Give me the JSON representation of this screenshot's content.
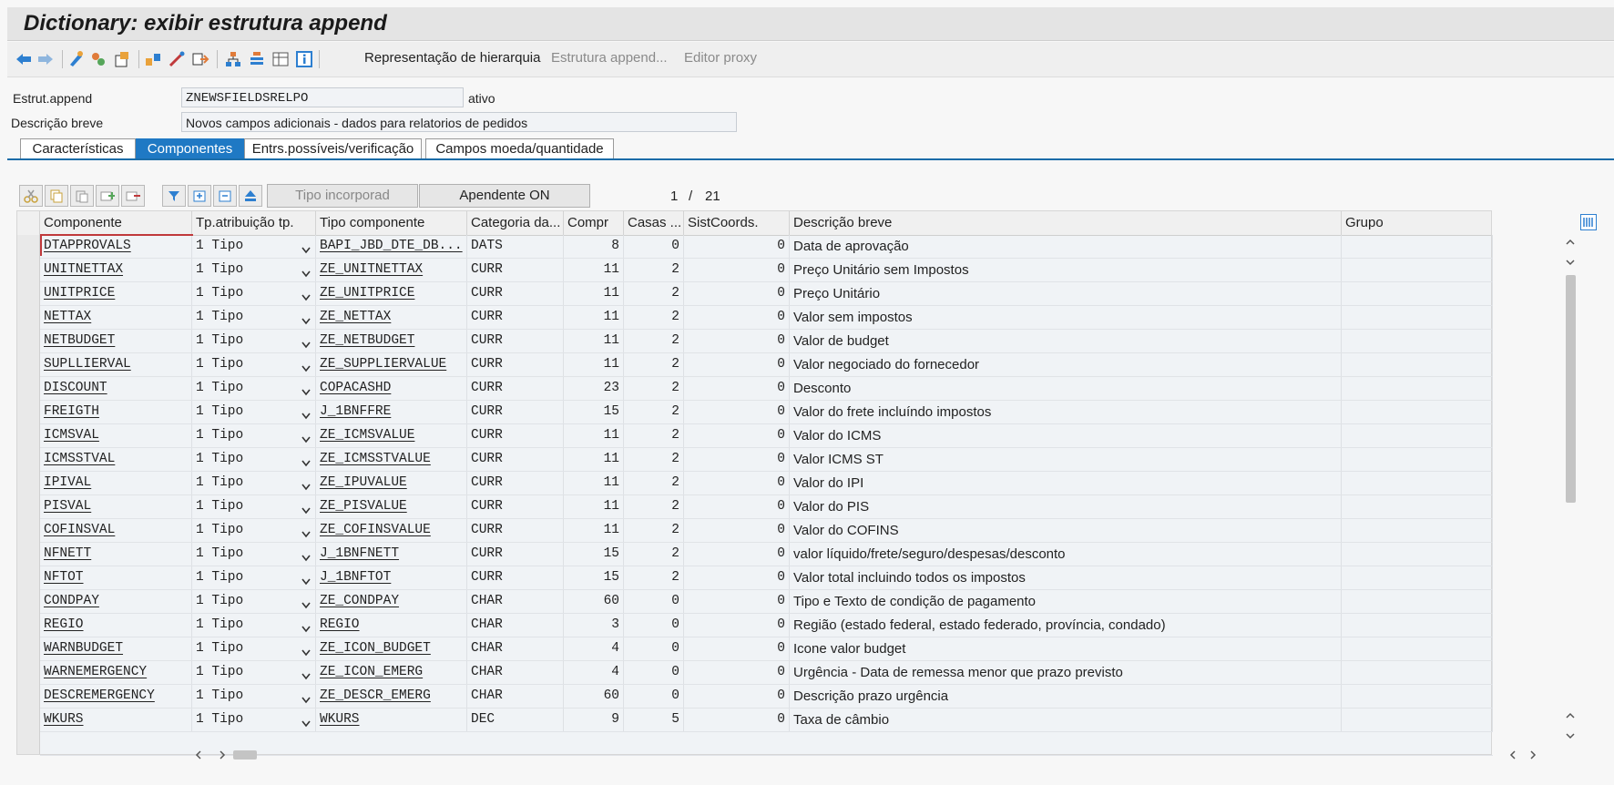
{
  "window": {
    "title": "Dictionary: exibir estrutura append"
  },
  "toolbar": {
    "icons": [
      "back-arrow-icon",
      "forward-arrow-icon",
      "display-change-icon",
      "activate-icon",
      "where-used-icon",
      "object-list-icon",
      "navigation-icon",
      "transport-icon",
      "hierarchy-icon",
      "list-icon",
      "table-icon",
      "info-icon"
    ],
    "hierarchy_label": "Representação de hierarquia",
    "append_label": "Estrutura append...",
    "proxy_label": "Editor proxy"
  },
  "header": {
    "append_label": "Estrut.append",
    "append_value": "ZNEWSFIELDSRELPO",
    "status": "ativo",
    "desc_label": "Descrição breve",
    "desc_value": "Novos campos adicionais - dados para relatorios de pedidos"
  },
  "tabs": [
    {
      "label": "Características",
      "active": false
    },
    {
      "label": "Componentes",
      "active": true
    },
    {
      "label": "Entrs.possíveis/verificação",
      "active": false
    },
    {
      "label": "Campos moeda/quantidade",
      "active": false
    }
  ],
  "grid_toolbar": {
    "tipo_btn": "Tipo incorporad",
    "apendente_btn": "Apendente ON",
    "page_current": "1",
    "page_sep": "/",
    "page_total": "21"
  },
  "columns": [
    "Componente",
    "Tp.atribuição tp.",
    "Tipo componente",
    "Categoria da...",
    "Compr",
    "Casas ...",
    "SistCoords.",
    "Descrição breve",
    "Grupo"
  ],
  "rows": [
    {
      "comp": "DTAPPROVALS",
      "tp": "1 Tipo",
      "type": "BAPI_JBD_DTE_DB...",
      "cat": "DATS",
      "len": "8",
      "dec": "0",
      "coord": "0",
      "desc": "Data de aprovação"
    },
    {
      "comp": "UNITNETTAX",
      "tp": "1 Tipo",
      "type": "ZE_UNITNETTAX",
      "cat": "CURR",
      "len": "11",
      "dec": "2",
      "coord": "0",
      "desc": "Preço Unitário sem Impostos"
    },
    {
      "comp": "UNITPRICE",
      "tp": "1 Tipo",
      "type": "ZE_UNITPRICE",
      "cat": "CURR",
      "len": "11",
      "dec": "2",
      "coord": "0",
      "desc": "Preço Unitário"
    },
    {
      "comp": "NETTAX",
      "tp": "1 Tipo",
      "type": "ZE_NETTAX",
      "cat": "CURR",
      "len": "11",
      "dec": "2",
      "coord": "0",
      "desc": "Valor sem impostos"
    },
    {
      "comp": "NETBUDGET",
      "tp": "1 Tipo",
      "type": "ZE_NETBUDGET",
      "cat": "CURR",
      "len": "11",
      "dec": "2",
      "coord": "0",
      "desc": "Valor de budget"
    },
    {
      "comp": "SUPLLIERVAL",
      "tp": "1 Tipo",
      "type": "ZE_SUPPLIERVALUE",
      "cat": "CURR",
      "len": "11",
      "dec": "2",
      "coord": "0",
      "desc": "Valor negociado do fornecedor"
    },
    {
      "comp": "DISCOUNT",
      "tp": "1 Tipo",
      "type": "COPACASHD",
      "cat": "CURR",
      "len": "23",
      "dec": "2",
      "coord": "0",
      "desc": "Desconto"
    },
    {
      "comp": "FREIGTH",
      "tp": "1 Tipo",
      "type": "J_1BNFFRE",
      "cat": "CURR",
      "len": "15",
      "dec": "2",
      "coord": "0",
      "desc": "Valor do frete incluíndo impostos"
    },
    {
      "comp": "ICMSVAL",
      "tp": "1 Tipo",
      "type": "ZE_ICMSVALUE",
      "cat": "CURR",
      "len": "11",
      "dec": "2",
      "coord": "0",
      "desc": "Valor do ICMS"
    },
    {
      "comp": "ICMSSTVAL",
      "tp": "1 Tipo",
      "type": "ZE_ICMSSTVALUE",
      "cat": "CURR",
      "len": "11",
      "dec": "2",
      "coord": "0",
      "desc": "Valor ICMS ST"
    },
    {
      "comp": "IPIVAL",
      "tp": "1 Tipo",
      "type": "ZE_IPUVALUE",
      "cat": "CURR",
      "len": "11",
      "dec": "2",
      "coord": "0",
      "desc": "Valor do IPI"
    },
    {
      "comp": "PISVAL",
      "tp": "1 Tipo",
      "type": "ZE_PISVALUE",
      "cat": "CURR",
      "len": "11",
      "dec": "2",
      "coord": "0",
      "desc": "Valor do PIS"
    },
    {
      "comp": "COFINSVAL",
      "tp": "1 Tipo",
      "type": "ZE_COFINSVALUE",
      "cat": "CURR",
      "len": "11",
      "dec": "2",
      "coord": "0",
      "desc": "Valor do COFINS"
    },
    {
      "comp": "NFNETT",
      "tp": "1 Tipo",
      "type": "J_1BNFNETT",
      "cat": "CURR",
      "len": "15",
      "dec": "2",
      "coord": "0",
      "desc": "valor líquido/frete/seguro/despesas/desconto"
    },
    {
      "comp": "NFTOT",
      "tp": "1 Tipo",
      "type": "J_1BNFTOT",
      "cat": "CURR",
      "len": "15",
      "dec": "2",
      "coord": "0",
      "desc": "Valor total incluindo todos os impostos"
    },
    {
      "comp": "CONDPAY",
      "tp": "1 Tipo",
      "type": "ZE_CONDPAY",
      "cat": "CHAR",
      "len": "60",
      "dec": "0",
      "coord": "0",
      "desc": "Tipo e Texto de condição de pagamento"
    },
    {
      "comp": "REGIO",
      "tp": "1 Tipo",
      "type": "REGIO",
      "cat": "CHAR",
      "len": "3",
      "dec": "0",
      "coord": "0",
      "desc": "Região (estado federal, estado federado, província, condado)"
    },
    {
      "comp": "WARNBUDGET",
      "tp": "1 Tipo",
      "type": "ZE_ICON_BUDGET",
      "cat": "CHAR",
      "len": "4",
      "dec": "0",
      "coord": "0",
      "desc": "Icone valor budget"
    },
    {
      "comp": "WARNEMERGENCY",
      "tp": "1 Tipo",
      "type": "ZE_ICON_EMERG",
      "cat": "CHAR",
      "len": "4",
      "dec": "0",
      "coord": "0",
      "desc": "Urgência - Data de remessa  menor que prazo previsto"
    },
    {
      "comp": "DESCREMERGENCY",
      "tp": "1 Tipo",
      "type": "ZE_DESCR_EMERG",
      "cat": "CHAR",
      "len": "60",
      "dec": "0",
      "coord": "0",
      "desc": "Descrição prazo urgência"
    },
    {
      "comp": "WKURS",
      "tp": "1 Tipo",
      "type": "WKURS",
      "cat": "DEC",
      "len": "9",
      "dec": "5",
      "coord": "0",
      "desc": "Taxa de câmbio"
    }
  ],
  "colors": {
    "accent": "#1f79c4",
    "tab_line": "#1b6ca8",
    "selection": "#c0393b"
  }
}
